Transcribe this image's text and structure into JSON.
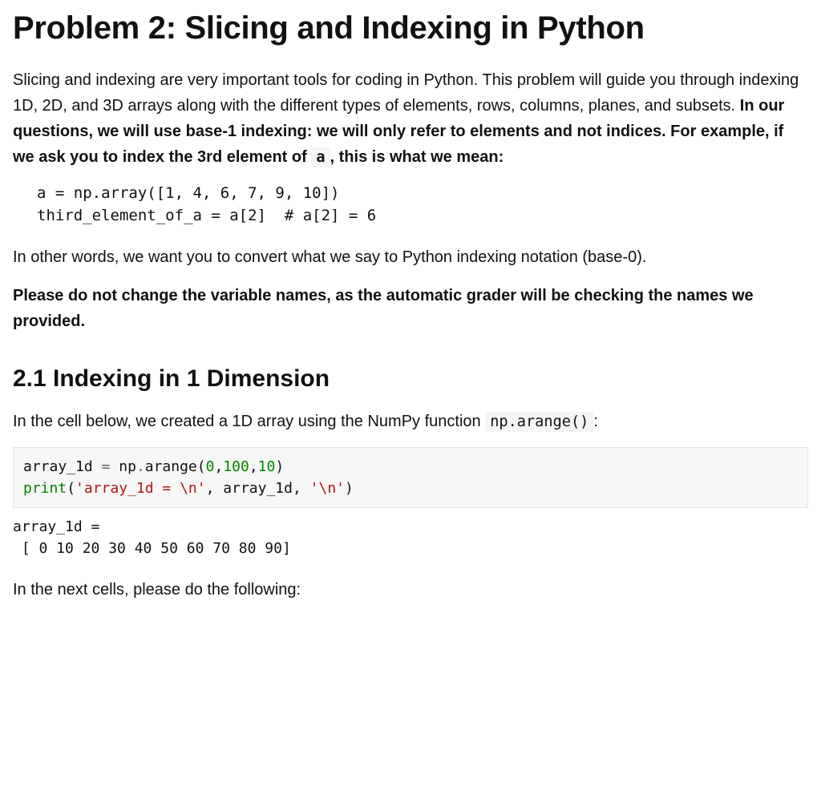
{
  "title": "Problem 2: Slicing and Indexing in Python",
  "intro": {
    "lead": "Slicing and indexing are very important tools for coding in Python. This problem will guide you through indexing 1D, 2D, and 3D arrays along with the different types of elements, rows, columns, planes, and subsets. ",
    "bold_before_code": "In our questions, we will use base-1 indexing: we will only refer to elements and not indices. For example, if we ask you to index the 3rd element of ",
    "code_token": "a",
    "bold_after_code": ", this is what we mean:"
  },
  "example_code": "a = np.array([1, 4, 6, 7, 9, 10])\nthird_element_of_a = a[2]  # a[2] = 6",
  "post_example": "In other words, we want you to convert what we say to Python indexing notation (base-0).",
  "warning": "Please do not change the variable names, as the automatic grader will be checking the names we provided.",
  "section21": {
    "heading": "2.1 Indexing in 1 Dimension",
    "intro_before_code": "In the cell below, we created a 1D array using the NumPy function ",
    "intro_code": "np.arange()",
    "intro_after_code": ":",
    "code_tokens": {
      "t1": "array_1d ",
      "op1": "=",
      "t2": " np",
      "op2": ".",
      "t3": "arange(",
      "n1": "0",
      "c1": ",",
      "n2": "100",
      "c2": ",",
      "n3": "10",
      "t4": ")",
      "line2a": "print",
      "t5": "(",
      "s1": "'array_1d = \\n'",
      "c3": ", array_1d, ",
      "s2": "'\\n'",
      "t6": ")"
    },
    "output": "array_1d = \n [ 0 10 20 30 40 50 60 70 80 90]",
    "followup": "In the next cells, please do the following:"
  }
}
